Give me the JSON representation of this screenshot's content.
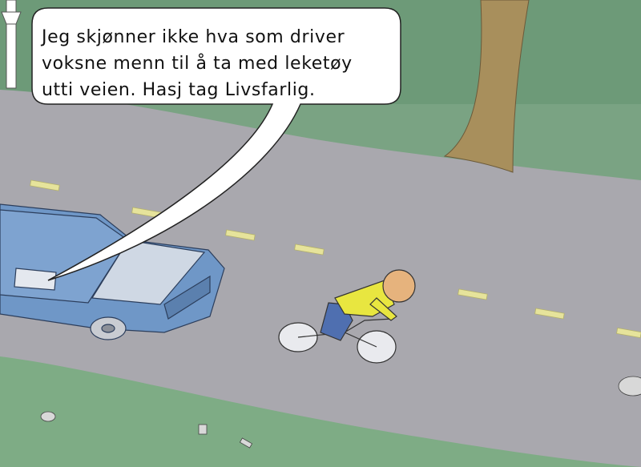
{
  "speech_bubble": {
    "lines": [
      "Jeg skjønner ikke hva som driver",
      "voksne menn til å ta med leketøy",
      "utti veien. Hasj tag Livsfarlig."
    ]
  },
  "colors": {
    "grass": "#7aa383",
    "road": "#a9a8ae",
    "lane_marking": "#e6e39b",
    "car_body": "#6f97c7",
    "tree_trunk": "#a88f5c",
    "cyclist_shirt": "#e8e640",
    "cyclist_pants": "#4f6fb0",
    "bubble_fill": "#ffffff"
  }
}
